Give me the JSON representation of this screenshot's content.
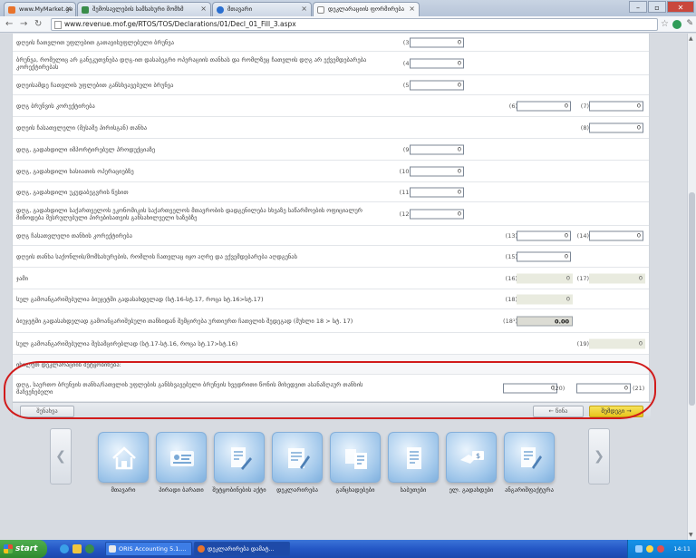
{
  "browser": {
    "tabs": [
      {
        "title": "www.MyMarket.ge - ფასიანი",
        "icon": "orange"
      },
      {
        "title": "შემოსავლების სამსახური მომხმ",
        "icon": "green"
      },
      {
        "title": "მთავარი",
        "icon": "blue"
      },
      {
        "title": "დეკლარაციის ფორმირება",
        "icon": "white"
      }
    ],
    "url": "www.revenue.mof.ge/RTOS/TOS/Declarations/01/Decl_01_Fill_3.aspx",
    "window_controls": [
      "–",
      "▫",
      "✕"
    ]
  },
  "form": {
    "rows": [
      {
        "label": "დღეის ჩათვლით უფლებით გათავისუფლებული ბრუნვა",
        "code": "(3)",
        "value": "0"
      },
      {
        "label": "ბრუნვა, რომელიც არ განეკუთვნება დღგ-ით დასაბეგრი ოპერაციის თანხას და რომლზეც ჩათვლის დღგ არ ექვემდებარება კორექტირებას",
        "code": "(4)",
        "value": "0"
      },
      {
        "label": "დღეისამდე ჩათვლის უფლებით განსხვავებული ბრუნვა",
        "code": "(5)",
        "value": "0"
      },
      {
        "label": "დღგ ბრუნვის კორექტირება",
        "code_a": "(6)",
        "value_a": "0",
        "code_b": "(7)",
        "value_b": "0"
      },
      {
        "label": "დღეის ჩასათვლელი (მესამე პირისგან) თანხა",
        "code_b": "(8)",
        "value_b": "0"
      },
      {
        "label": "დღგ, გადახდილი იმპორტირებულ პროდუქციაზე",
        "code": "(9)",
        "value": "0"
      },
      {
        "label": "დღგ, გადახდილი ხასიათის ოპერაციებზე",
        "code": "(10)",
        "value": "0"
      },
      {
        "label": "დღგ, გადახდილი უკუდაბეგვრის წესით",
        "code": "(11)",
        "value": "0"
      },
      {
        "label": "დღგ, გადახდილი საქართველოს ეკონომიკის საქართველოს მთავრობის დადგენილება სხვაზე საწარმოების ოფიციალურ მიწოდება შესრულებული პირებისათვის განსახილველი ხაზებზე",
        "code": "(12)",
        "value": "0"
      },
      {
        "label": "დღგ ჩასათვლელი თანხის კორექტირება",
        "code_a": "(13)",
        "value_a": "0",
        "code_b": "(14)",
        "value_b": "0"
      },
      {
        "label": "დღეის თანხა საქონლის/მომსახურების, რომლის ჩათვლაც იყო აღრე და ექვემდებარება აღდგენას",
        "code": "(15)",
        "value": "0"
      },
      {
        "label": "ჯამი",
        "code_a": "(16)",
        "value_a": "0",
        "code_b": "(17)",
        "value_b": "0",
        "readonly": true
      },
      {
        "label": "სულ გამოანგარიშებულია ბიუჯეტში გადასახდელად (სტ.16-სტ.17, როცა სტ.16>სტ.17)",
        "code": "(18)",
        "value": "0",
        "readonly": true
      },
      {
        "label": "ბიუჯეტში გადასახდელად გამოანგარიშებული თანხიდან შემცირება ურთიერთ ჩათვლის შედეგად (მუხლი 18 > სტ. 17)",
        "code": "(18¹)",
        "value": "0.00",
        "readonly_dark": true
      },
      {
        "label": "სულ გამოანგარიშებულია შესამცირებლად (სტ.17-სტ.16, როცა სტ.17>სტ.16)",
        "code_b": "(19)",
        "value_b": "0",
        "readonly": true
      },
      {
        "label": "იხილეთ დეკლარაციის შეტყობინება:",
        "section": true
      },
      {
        "label": "დღგ, საერთო ბრუნვის თანხა/ჩათვლის უფლების განსხვავებული ბრუნვის ხვედრითი წონის მიხედვით ასანაზღაურ თანხის მაჩვენებელი",
        "code_a": "(20)",
        "value_a": "0",
        "code_b": "(21)",
        "value_b": "0"
      }
    ],
    "buttons": {
      "save": "შენახვა",
      "back": "← წინა",
      "next": "შემდეგი →"
    }
  },
  "dock": {
    "items": [
      {
        "label": "მთავარი",
        "icon": "home-icon"
      },
      {
        "label": "პირადი ბარათი",
        "icon": "id-card-icon"
      },
      {
        "label": "შეტყობინების აქტი",
        "icon": "document-pen-icon"
      },
      {
        "label": "დეკლარირება",
        "icon": "declaration-icon"
      },
      {
        "label": "განცხადებები",
        "icon": "applications-icon"
      },
      {
        "label": "საბუთები",
        "icon": "documents-icon"
      },
      {
        "label": "ელ. გადახდები",
        "icon": "payment-icon"
      },
      {
        "label": "ანგარიშფაქტურა",
        "icon": "invoice-icon"
      }
    ]
  },
  "taskbar": {
    "start": "start",
    "tasks": [
      {
        "label": "ORIS Accounting 5.1...."
      },
      {
        "label": "დეკლარირება დამატ..."
      }
    ],
    "lang": "EN",
    "clock": "14:11"
  }
}
